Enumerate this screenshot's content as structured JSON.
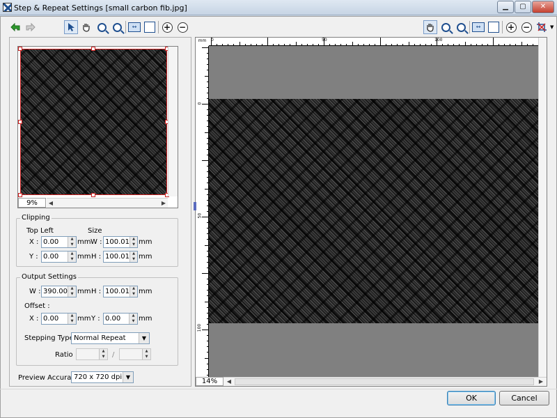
{
  "window": {
    "title": "Step & Repeat Settings [small carbon fib.jpg]",
    "minimize": "▁",
    "maximize": "▢",
    "close": "✕"
  },
  "toolbar_left": {
    "icons": [
      "back-arrow-icon",
      "forward-arrow-icon",
      "pointer-icon",
      "hand-icon",
      "zoom-in-icon",
      "zoom-out-icon",
      "fit-width-icon",
      "fit-page-icon",
      "plus-icon",
      "minus-icon"
    ]
  },
  "toolbar_right": {
    "icons": [
      "hand-icon",
      "zoom-in-icon",
      "zoom-out-icon",
      "fit-width-icon",
      "fit-page-icon",
      "plus-icon",
      "minus-icon",
      "crop-tool-icon"
    ]
  },
  "thumbnail": {
    "zoom": "9%"
  },
  "clipping": {
    "group_label": "Clipping",
    "top_left_label": "Top Left",
    "size_label": "Size",
    "x_label": "X :",
    "y_label": "Y :",
    "w_label": "W :",
    "h_label": "H :",
    "x": "0.00",
    "y": "0.00",
    "w": "100.01",
    "h": "100.01",
    "unit": "mm"
  },
  "output": {
    "group_label": "Output Settings",
    "w_label": "W :",
    "h_label": "H :",
    "w": "390.00",
    "h": "100.01",
    "offset_label": "Offset :",
    "offset_x_label": "X :",
    "offset_y_label": "Y :",
    "offset_x": "0.00",
    "offset_y": "0.00",
    "unit": "mm",
    "stepping_type_label": "Stepping Type",
    "stepping_type": "Normal Repeat",
    "ratio_label": "Ratio :",
    "ratio_sep": "/"
  },
  "preview_accuracy": {
    "label": "Preview Accuracy :",
    "value": "720 x 720 dpi"
  },
  "main_view": {
    "zoom": "14%",
    "ruler_h_labels": [
      "0",
      "50",
      "100"
    ],
    "ruler_v_labels": [
      "0",
      "50",
      "100"
    ],
    "ruler_unit": "mm"
  },
  "buttons": {
    "ok": "OK",
    "cancel": "Cancel"
  },
  "colors": {
    "canvas_gray": "#808080",
    "selection_red": "#cc2020",
    "accent_blue": "#1f4f8f"
  }
}
